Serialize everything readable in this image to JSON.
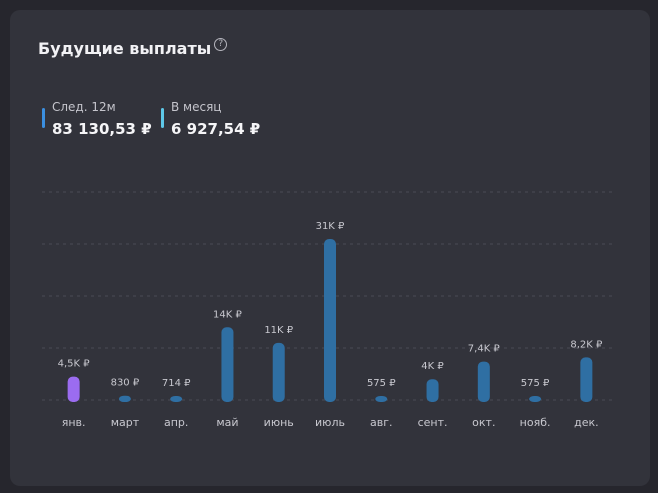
{
  "header": {
    "title": "Будущие выплаты",
    "help_icon": "?"
  },
  "stats": [
    {
      "label": "След. 12м",
      "value": "83 130,53 ₽",
      "color": "#3b8fe0"
    },
    {
      "label": "В месяц",
      "value": "6 927,54 ₽",
      "color": "#5ec8e8"
    }
  ],
  "colors": {
    "bar": "#2f6fa3",
    "bar_highlight": "#9b6cf0",
    "grid": "#4a4b55",
    "value_label": "#c8c8cf",
    "tick_label": "#c8c8cf"
  },
  "chart_data": {
    "type": "bar",
    "categories": [
      "янв.",
      "март",
      "апр.",
      "май",
      "июнь",
      "июль",
      "авг.",
      "сент.",
      "окт.",
      "нояб.",
      "дек."
    ],
    "values": [
      4500,
      830,
      714,
      14000,
      11000,
      31000,
      575,
      4000,
      7400,
      575,
      8200
    ],
    "value_labels": [
      "4,5K ₽",
      "830 ₽",
      "714 ₽",
      "14K ₽",
      "11K ₽",
      "31K ₽",
      "575 ₽",
      "4K ₽",
      "7,4K ₽",
      "575 ₽",
      "8,2K ₽"
    ],
    "highlight_index": 0,
    "ylim": [
      0,
      31000
    ],
    "grid": true
  }
}
